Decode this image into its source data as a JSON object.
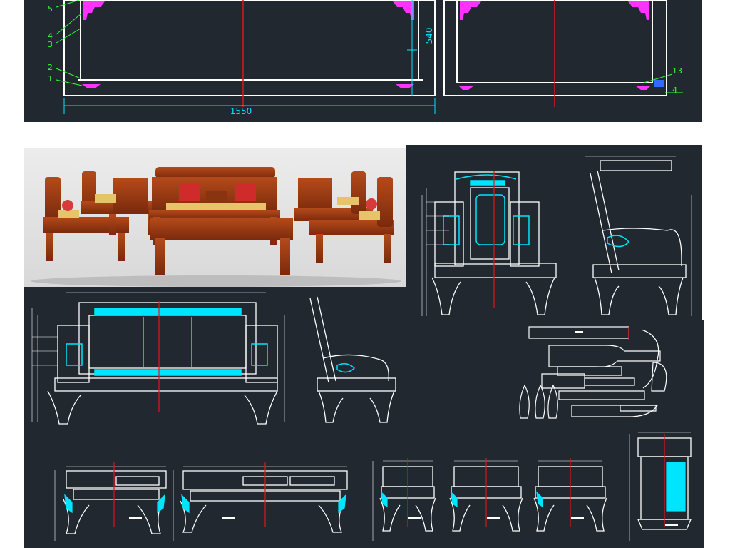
{
  "colors": {
    "background": "#212830",
    "outline": "#ffffff",
    "dimension": "#00e5ff",
    "centerline": "#e0141c",
    "carving": "#ff33ff",
    "leader": "#33ff33",
    "accent": "#2f6bff",
    "wood": "#9a3a12"
  },
  "top_drawing": {
    "width_dim": "1550",
    "height_dim": "540",
    "callouts_left": [
      "5",
      "4",
      "3",
      "2",
      "1"
    ],
    "callouts_right": [
      "13",
      "4"
    ]
  }
}
